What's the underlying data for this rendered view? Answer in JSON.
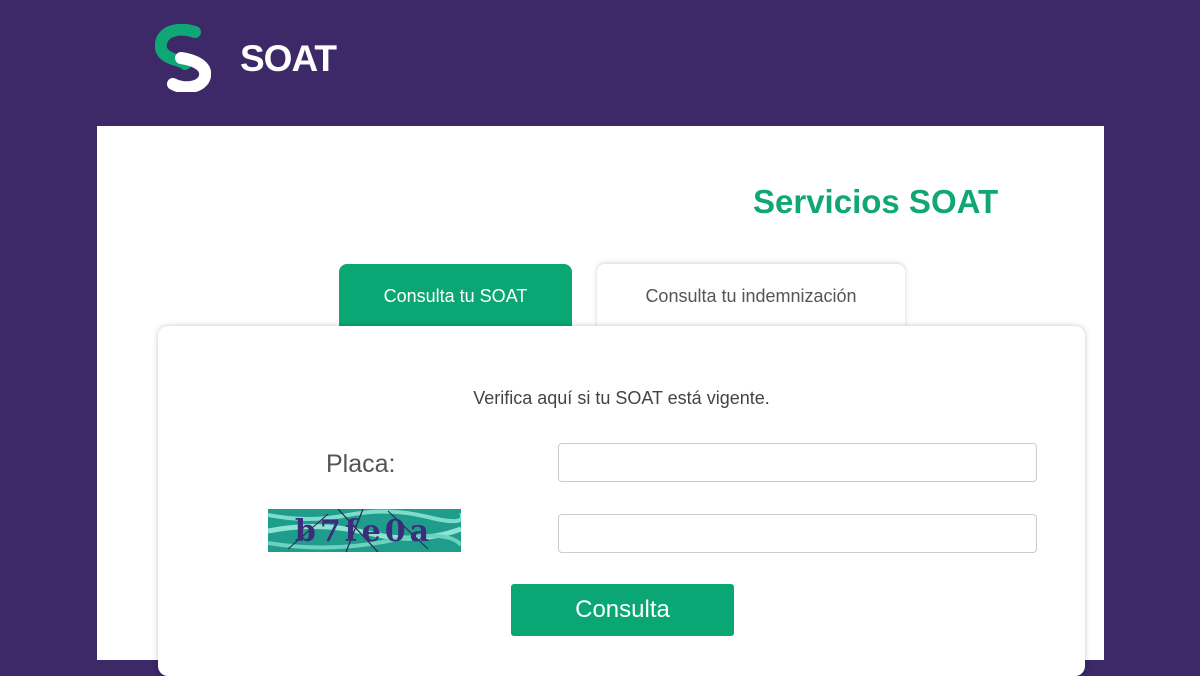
{
  "header": {
    "logo_text": "SOAT",
    "logo_icon": "soat-s-logo",
    "brand_color": "#10a676",
    "background_color": "#3d2868"
  },
  "main": {
    "title": "Servicios SOAT",
    "tabs": [
      {
        "label": "Consulta tu SOAT",
        "active": true
      },
      {
        "label": "Consulta tu indemnización",
        "active": false
      }
    ],
    "subtitle": "Verifica aquí si tu SOAT está vigente.",
    "form": {
      "placa_label": "Placa:",
      "placa_value": "",
      "captcha_text": "b7fe0a",
      "captcha_value": "",
      "submit_label": "Consulta"
    }
  }
}
